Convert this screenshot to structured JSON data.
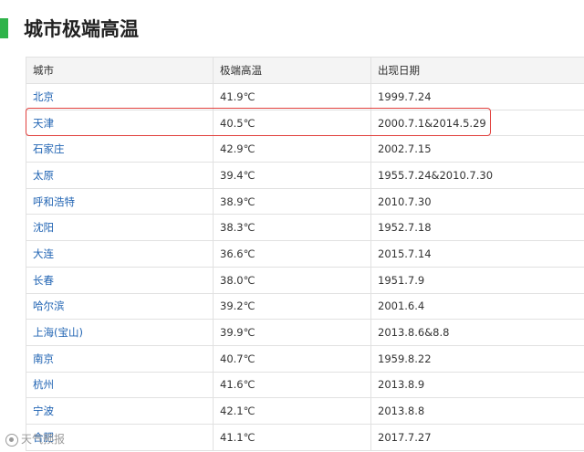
{
  "heading": {
    "title": "城市极端高温",
    "accent_color": "#2fb34a"
  },
  "table": {
    "headers": [
      "城市",
      "极端高温",
      "出现日期"
    ],
    "rows": [
      [
        "北京",
        "41.9℃",
        "1999.7.24"
      ],
      [
        "天津",
        "40.5℃",
        "2000.7.1&2014.5.29"
      ],
      [
        "石家庄",
        "42.9℃",
        "2002.7.15"
      ],
      [
        "太原",
        "39.4℃",
        "1955.7.24&2010.7.30"
      ],
      [
        "呼和浩特",
        "38.9℃",
        "2010.7.30"
      ],
      [
        "沈阳",
        "38.3℃",
        "1952.7.18"
      ],
      [
        "大连",
        "36.6℃",
        "2015.7.14"
      ],
      [
        "长春",
        "38.0℃",
        "1951.7.9"
      ],
      [
        "哈尔滨",
        "39.2℃",
        "2001.6.4"
      ],
      [
        "上海(宝山)",
        "39.9℃",
        "2013.8.6&8.8"
      ],
      [
        "南京",
        "40.7℃",
        "1959.8.22"
      ],
      [
        "杭州",
        "41.6℃",
        "2013.8.9"
      ],
      [
        "宁波",
        "42.1℃",
        "2013.8.8"
      ],
      [
        "合肥",
        "41.1℃",
        "2017.7.27"
      ]
    ],
    "highlight_color": "#e1403d"
  },
  "watermark": {
    "text": "天气预报"
  }
}
